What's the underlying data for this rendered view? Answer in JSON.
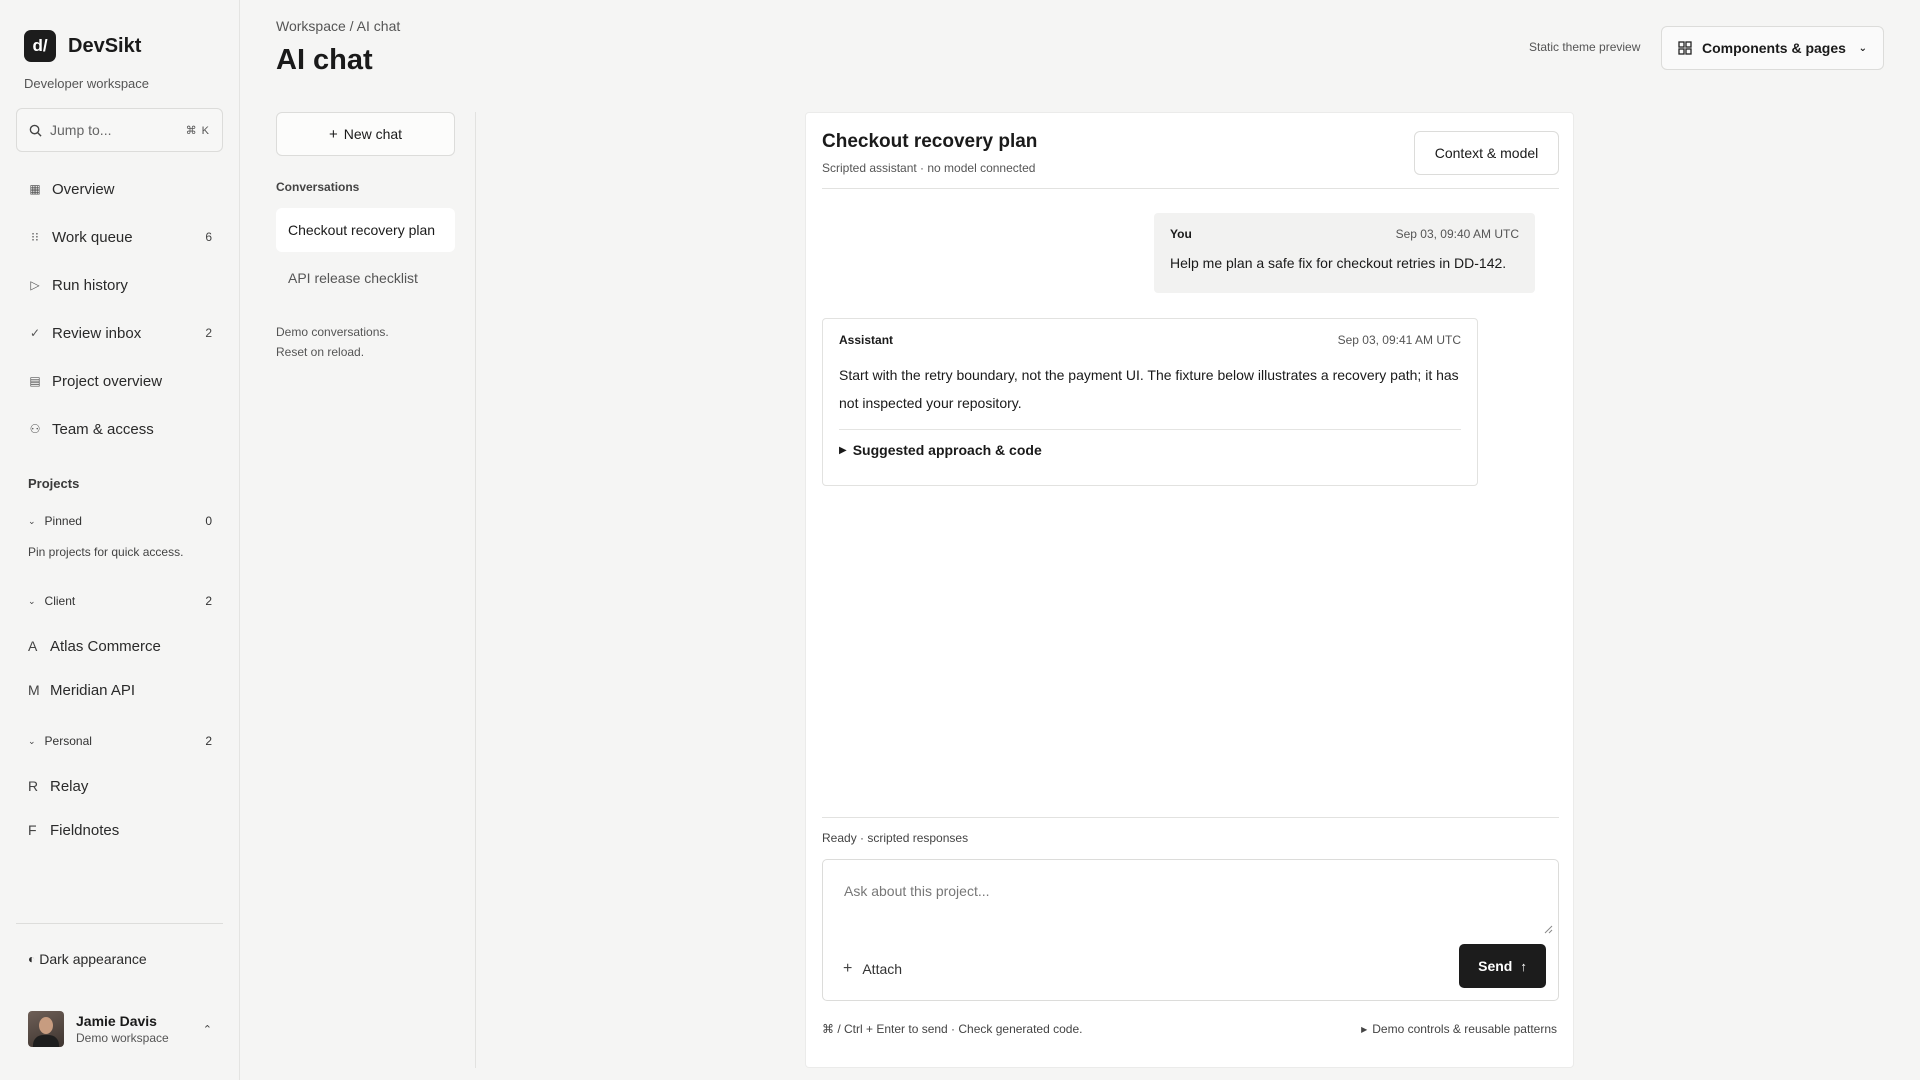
{
  "sidebar": {
    "brand": {
      "logo": "d/",
      "name": "DevSikt",
      "subtitle": "Developer workspace"
    },
    "jump": {
      "placeholder": "Jump to...",
      "shortcut": "⌘ K"
    },
    "nav": [
      {
        "label": "Overview",
        "icon": "grid-icon",
        "glyph": "▦",
        "count": ""
      },
      {
        "label": "Work queue",
        "icon": "list-icon",
        "glyph": "⁝⁝",
        "count": "6"
      },
      {
        "label": "Run history",
        "icon": "play-icon",
        "glyph": "▷",
        "count": ""
      },
      {
        "label": "Review inbox",
        "icon": "check-icon",
        "glyph": "✓",
        "count": "2"
      },
      {
        "label": "Project overview",
        "icon": "table-icon",
        "glyph": "▤",
        "count": ""
      },
      {
        "label": "Team & access",
        "icon": "users-icon",
        "glyph": "⚇",
        "count": ""
      }
    ],
    "projects_title": "Projects",
    "groups": {
      "pinned": {
        "label": "Pinned",
        "count": "0",
        "hint": "Pin projects for quick access."
      },
      "client": {
        "label": "Client",
        "count": "2",
        "items": [
          {
            "initial": "A",
            "label": "Atlas Commerce"
          },
          {
            "initial": "M",
            "label": "Meridian API"
          }
        ]
      },
      "personal": {
        "label": "Personal",
        "count": "2",
        "items": [
          {
            "initial": "R",
            "label": "Relay"
          },
          {
            "initial": "F",
            "label": "Fieldnotes"
          }
        ]
      }
    },
    "appearance": {
      "icon": "half-moon-icon",
      "label": "Dark appearance"
    },
    "user": {
      "name": "Jamie Davis",
      "workspace": "Demo workspace"
    }
  },
  "header": {
    "breadcrumb": "Workspace / AI chat",
    "title": "AI chat",
    "theme_note": "Static theme preview",
    "components_button": "Components & pages"
  },
  "conversations": {
    "new_chat": "New chat",
    "title": "Conversations",
    "items": [
      {
        "label": "Checkout recovery plan",
        "active": true
      },
      {
        "label": "API release checklist",
        "active": false
      }
    ],
    "note_line1": "Demo conversations.",
    "note_line2": "Reset on reload."
  },
  "chat": {
    "title": "Checkout recovery plan",
    "subtitle": "Scripted assistant · no model connected",
    "context_button": "Context & model",
    "messages": [
      {
        "author": "You",
        "timestamp": "Sep 03, 09:40 AM UTC",
        "text": "Help me plan a safe fix for checkout retries in DD-142."
      },
      {
        "author": "Assistant",
        "timestamp": "Sep 03, 09:41 AM UTC",
        "text": "Start with the retry boundary, not the payment UI. The fixture below illustrates a recovery path; it has not inspected your repository.",
        "details_summary": "Suggested approach & code"
      }
    ],
    "status": "Ready · scripted responses",
    "composer": {
      "placeholder": "Ask about this project...",
      "attach": "Attach",
      "send": "Send"
    },
    "footer_hint": "⌘ / Ctrl + Enter to send · Check generated code.",
    "footer_demo": "Demo controls & reusable patterns"
  },
  "colors": {
    "accent": "#1c1c1c",
    "background": "#f5f5f4",
    "surface": "#ffffff",
    "border": "#dcdcda"
  }
}
